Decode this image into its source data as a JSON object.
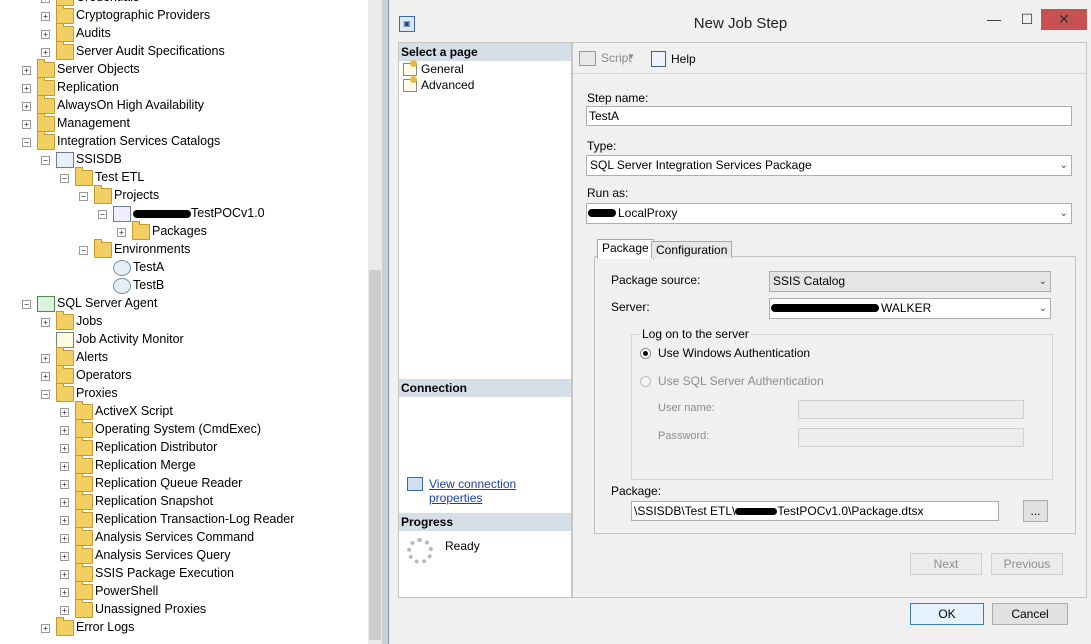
{
  "tree": {
    "items": [
      {
        "label": "Credentials",
        "icon": "folder-icon",
        "expander": "+"
      },
      {
        "label": "Cryptographic Providers",
        "icon": "folder-icon",
        "expander": "+"
      },
      {
        "label": "Audits",
        "icon": "folder-icon",
        "expander": "+"
      },
      {
        "label": "Server Audit Specifications",
        "icon": "folder-icon",
        "expander": "+"
      },
      {
        "label": "Server Objects",
        "icon": "folder-icon",
        "expander": "+"
      },
      {
        "label": "Replication",
        "icon": "folder-icon",
        "expander": "+"
      },
      {
        "label": "AlwaysOn High Availability",
        "icon": "folder-icon",
        "expander": "+"
      },
      {
        "label": "Management",
        "icon": "folder-icon",
        "expander": "+"
      },
      {
        "label": "Integration Services Catalogs",
        "icon": "folder-icon",
        "expander": "−"
      },
      {
        "label": "SSISDB",
        "icon": "database-icon",
        "expander": "−"
      },
      {
        "label": "Test ETL",
        "icon": "folder-icon",
        "expander": "−"
      },
      {
        "label": "Projects",
        "icon": "folder-icon",
        "expander": "−"
      },
      {
        "label": "TestPOCv1.0",
        "icon": "project-icon",
        "expander": "−"
      },
      {
        "label": "Packages",
        "icon": "folder-icon",
        "expander": "+"
      },
      {
        "label": "Environments",
        "icon": "folder-icon",
        "expander": "−"
      },
      {
        "label": "TestA",
        "icon": "environment-icon",
        "expander": ""
      },
      {
        "label": "TestB",
        "icon": "environment-icon",
        "expander": ""
      },
      {
        "label": "SQL Server Agent",
        "icon": "sql-agent-icon",
        "expander": "−"
      },
      {
        "label": "Jobs",
        "icon": "folder-icon",
        "expander": "+"
      },
      {
        "label": "Job Activity Monitor",
        "icon": "job-monitor-icon",
        "expander": ""
      },
      {
        "label": "Alerts",
        "icon": "folder-icon",
        "expander": "+"
      },
      {
        "label": "Operators",
        "icon": "folder-icon",
        "expander": "+"
      },
      {
        "label": "Proxies",
        "icon": "folder-icon",
        "expander": "−"
      },
      {
        "label": "ActiveX Script",
        "icon": "folder-icon",
        "expander": "+"
      },
      {
        "label": "Operating System (CmdExec)",
        "icon": "folder-icon",
        "expander": "+"
      },
      {
        "label": "Replication Distributor",
        "icon": "folder-icon",
        "expander": "+"
      },
      {
        "label": "Replication Merge",
        "icon": "folder-icon",
        "expander": "+"
      },
      {
        "label": "Replication Queue Reader",
        "icon": "folder-icon",
        "expander": "+"
      },
      {
        "label": "Replication Snapshot",
        "icon": "folder-icon",
        "expander": "+"
      },
      {
        "label": "Replication Transaction-Log Reader",
        "icon": "folder-icon",
        "expander": "+"
      },
      {
        "label": "Analysis Services Command",
        "icon": "folder-icon",
        "expander": "+"
      },
      {
        "label": "Analysis Services Query",
        "icon": "folder-icon",
        "expander": "+"
      },
      {
        "label": "SSIS Package Execution",
        "icon": "folder-icon",
        "expander": "+"
      },
      {
        "label": "PowerShell",
        "icon": "folder-icon",
        "expander": "+"
      },
      {
        "label": "Unassigned Proxies",
        "icon": "folder-icon",
        "expander": "+"
      },
      {
        "label": "Error Logs",
        "icon": "folder-icon",
        "expander": "+"
      }
    ]
  },
  "dialog": {
    "title": "New Job Step",
    "window_controls": {
      "minimize": "—",
      "maximize": "☐",
      "close": "✕"
    },
    "left_pane": {
      "select_page_header": "Select a page",
      "pages": [
        "General",
        "Advanced"
      ],
      "connection_header": "Connection",
      "connection_link": "View connection properties",
      "progress_header": "Progress",
      "progress_status": "Ready"
    },
    "toolbar": {
      "script_label": "Script",
      "script_dropdown": "▾",
      "help_label": "Help"
    },
    "form": {
      "step_name_label": "Step name:",
      "step_name_value": "TestA",
      "type_label": "Type:",
      "type_value": "SQL Server Integration Services Package",
      "run_as_label": "Run as:",
      "run_as_value": "LocalProxy",
      "combo_arrow": "⌄"
    },
    "tabs": {
      "package": "Package",
      "configuration": "Configuration"
    },
    "package_tab": {
      "package_source_label": "Package source:",
      "package_source_value": "SSIS Catalog",
      "server_label": "Server:",
      "server_value": "WALKER",
      "logon_legend": "Log on to the server",
      "windows_auth_label": "Use Windows Authentication",
      "sql_auth_label": "Use SQL Server Authentication",
      "user_name_label": "User name:",
      "password_label": "Password:",
      "package_label": "Package:",
      "package_path_prefix": "\\SSISDB\\Test ETL\\",
      "package_path_suffix": "TestPOCv1.0\\Package.dtsx",
      "browse_label": "...",
      "next_label": "Next",
      "previous_label": "Previous"
    },
    "footer": {
      "ok_label": "OK",
      "cancel_label": "Cancel"
    }
  }
}
